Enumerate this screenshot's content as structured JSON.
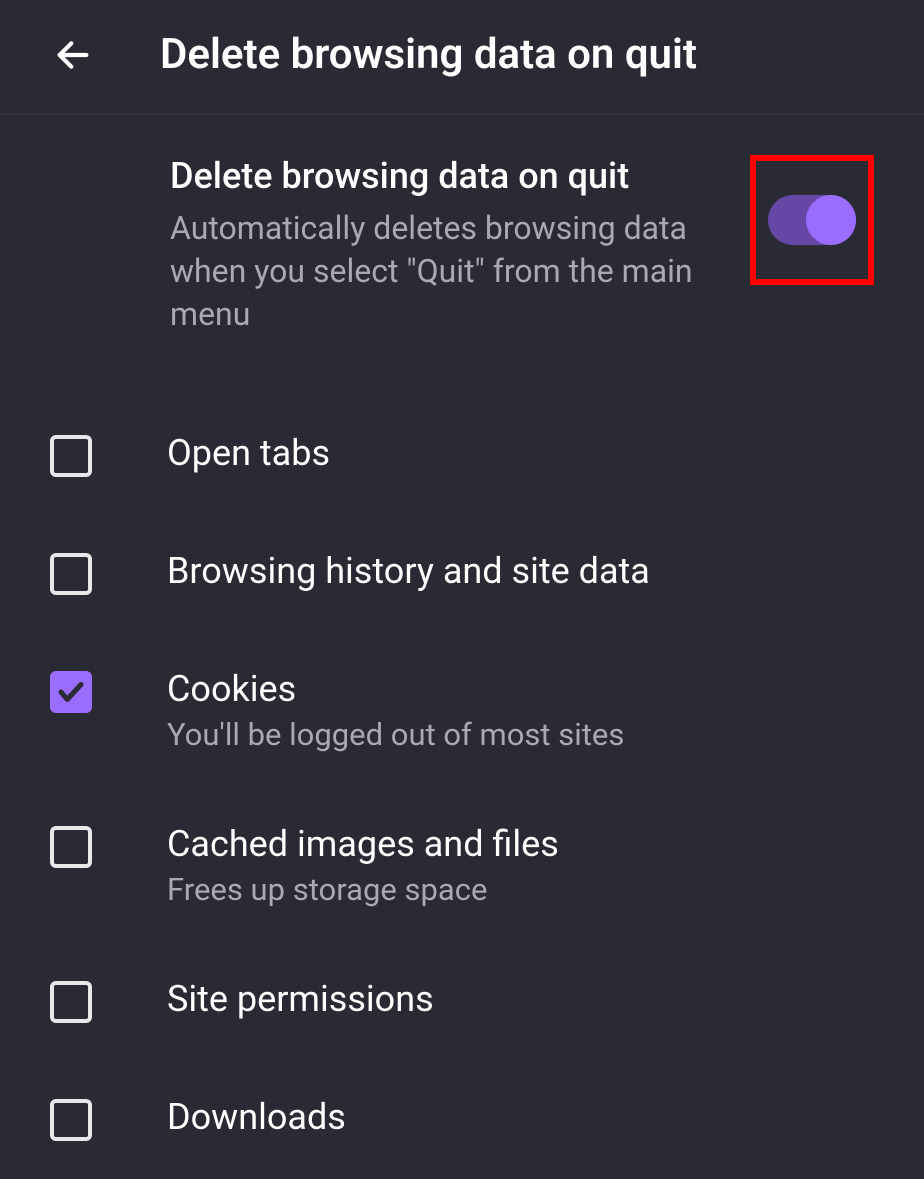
{
  "header": {
    "title": "Delete browsing data on quit"
  },
  "mainToggle": {
    "title": "Delete browsing data on quit",
    "description": "Automatically deletes browsing data when you select \"Quit\" from the main menu",
    "enabled": true
  },
  "items": [
    {
      "title": "Open tabs",
      "subtitle": "",
      "checked": false
    },
    {
      "title": "Browsing history and site data",
      "subtitle": "",
      "checked": false
    },
    {
      "title": "Cookies",
      "subtitle": "You'll be logged out of most sites",
      "checked": true
    },
    {
      "title": "Cached images and files",
      "subtitle": "Frees up storage space",
      "checked": false
    },
    {
      "title": "Site permissions",
      "subtitle": "",
      "checked": false
    },
    {
      "title": "Downloads",
      "subtitle": "",
      "checked": false
    }
  ]
}
